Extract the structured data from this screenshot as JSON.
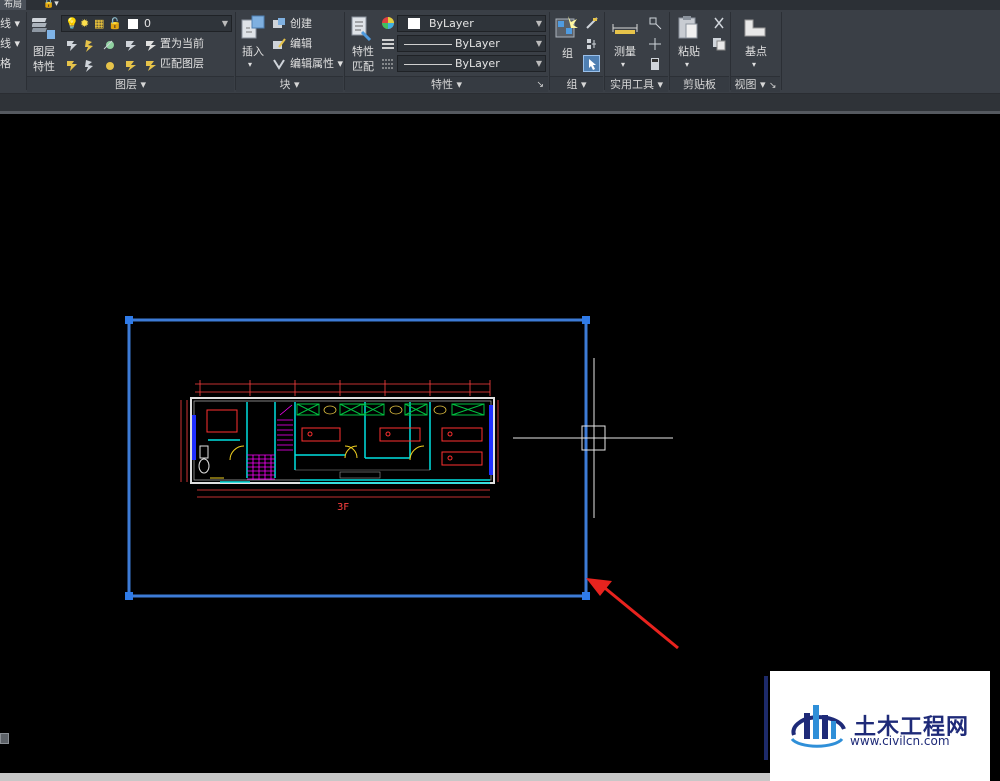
{
  "ribbon": {
    "layout_tab": "布局",
    "layer_group": {
      "left_items": [
        "线 ▾",
        "线 ▾",
        "格"
      ],
      "layer_props_btn": "图层\n特性",
      "layer_combo": "0",
      "set_current": "置为当前",
      "match_layer": "匹配图层",
      "footer": "图层 ▾"
    },
    "block_group": {
      "insert": "插入",
      "create": "创建",
      "edit": "编辑",
      "edit_attr": "编辑属性 ▾",
      "footer": "块 ▾"
    },
    "properties_group": {
      "match_props": "特性\n匹配",
      "color_combo": "ByLayer",
      "linetype_combo": "ByLayer",
      "lineweight_combo": "ByLayer",
      "footer": "特性 ▾"
    },
    "group_group": {
      "group_btn": "组",
      "footer": "组 ▾"
    },
    "utilities_group": {
      "measure": "测量",
      "footer": "实用工具 ▾"
    },
    "clipboard_group": {
      "paste": "粘贴",
      "footer": "剪贴板"
    },
    "view_group": {
      "base": "基点",
      "footer": "视图 ▾"
    }
  },
  "drawing": {
    "floor_label": "3F"
  },
  "watermark": {
    "title": "土木工程网",
    "url": "www.civilcn.com"
  },
  "colors": {
    "selection_blue": "#3d7bd6",
    "cyan": "#00e0e0",
    "red": "#ff3030",
    "magenta": "#ff00ff",
    "green": "#00c040",
    "arrow_red": "#e8231e"
  }
}
